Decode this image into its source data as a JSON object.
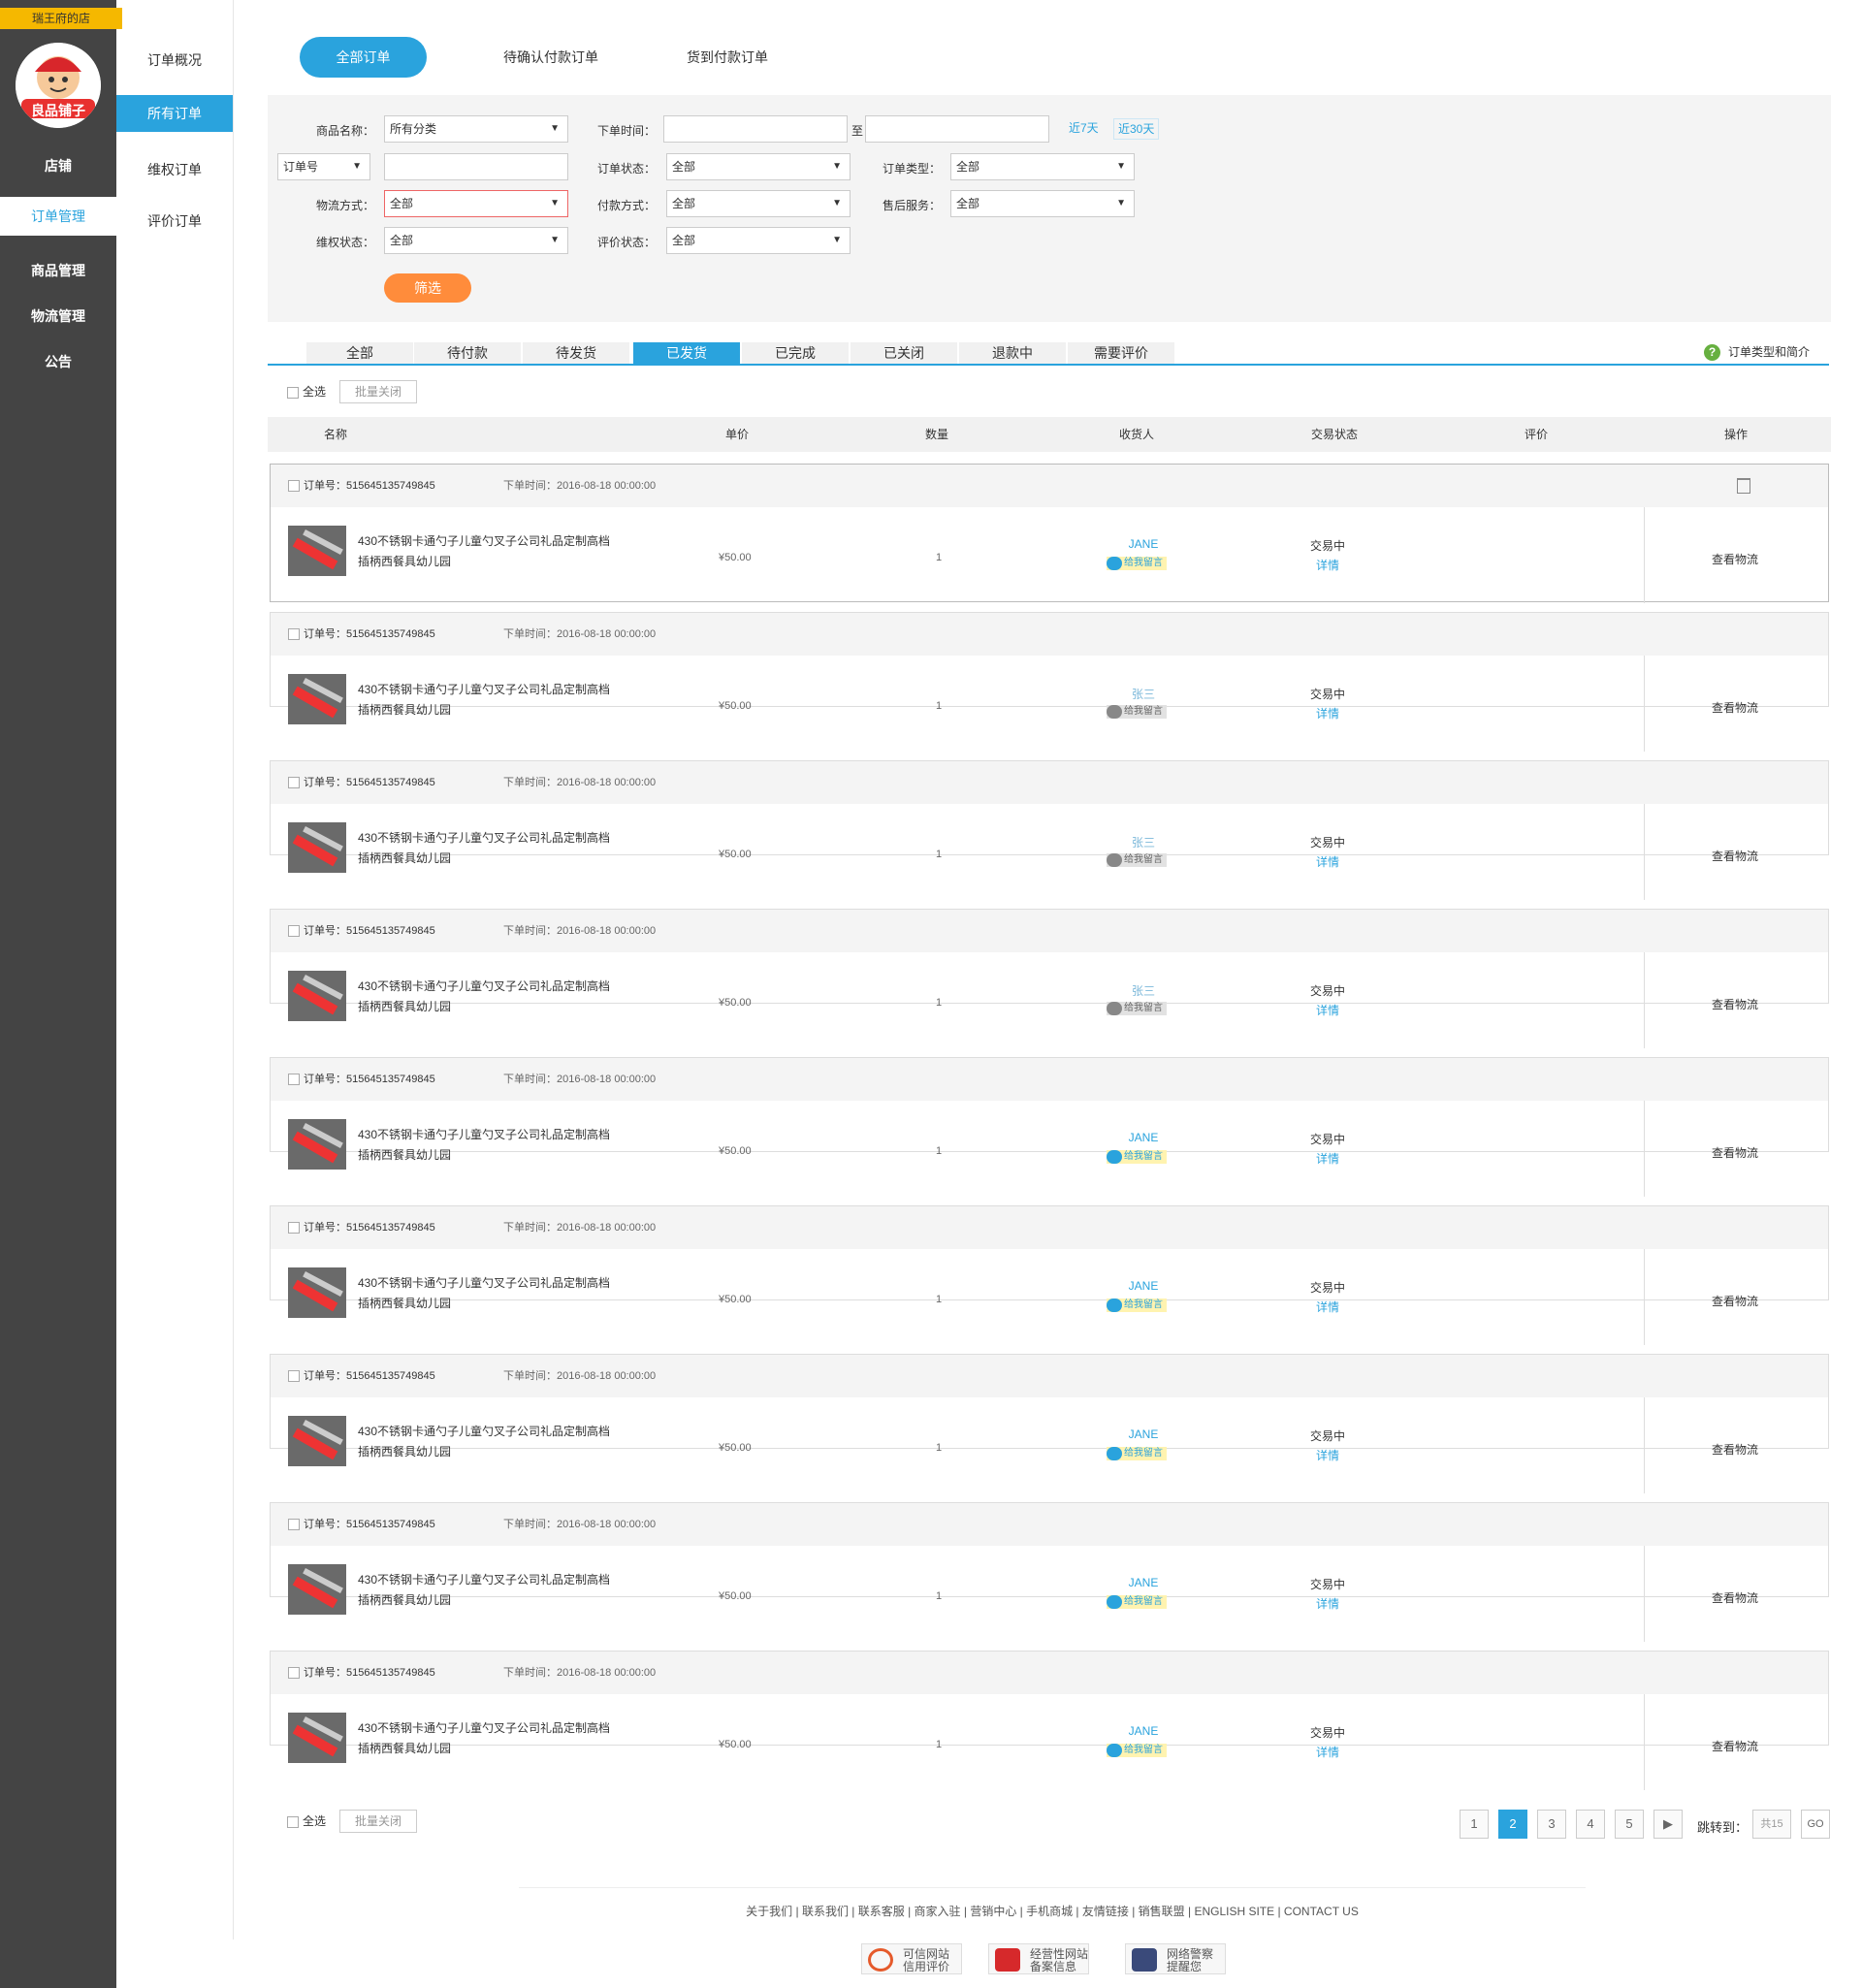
{
  "shop": {
    "name": "瑞王府的店",
    "logo_text": "良品铺子"
  },
  "sidebar": {
    "items": [
      {
        "label": "店铺",
        "active": false
      },
      {
        "label": "订单管理",
        "active": true
      },
      {
        "label": "商品管理",
        "active": false
      },
      {
        "label": "物流管理",
        "active": false
      },
      {
        "label": "公告",
        "active": false
      }
    ]
  },
  "subnav": {
    "items": [
      {
        "label": "订单概况",
        "active": false
      },
      {
        "label": "所有订单",
        "active": true
      },
      {
        "label": "维权订单",
        "active": false
      },
      {
        "label": "评价订单",
        "active": false
      }
    ]
  },
  "top_tabs": [
    {
      "label": "全部订单",
      "active": true
    },
    {
      "label": "待确认付款订单",
      "active": false
    },
    {
      "label": "货到付款订单",
      "active": false
    }
  ],
  "filter": {
    "product_name_label": "商品名称：",
    "product_name_value": "所有分类",
    "order_time_label": "下单时间：",
    "to_label": "至",
    "last7": "近7天",
    "last30": "近30天",
    "order_no_select": "订单号",
    "order_status_label": "订单状态：",
    "order_status_value": "全部",
    "order_type_label": "订单类型：",
    "order_type_value": "全部",
    "logistics_label": "物流方式：",
    "logistics_value": "全部",
    "payment_label": "付款方式：",
    "payment_value": "全部",
    "aftersale_label": "售后服务：",
    "aftersale_value": "全部",
    "rights_label": "维权状态：",
    "rights_value": "全部",
    "review_label": "评价状态：",
    "review_value": "全部",
    "submit": "筛选"
  },
  "status_tabs": [
    {
      "label": "全部",
      "active": false
    },
    {
      "label": "待付款",
      "active": false
    },
    {
      "label": "待发货",
      "active": false
    },
    {
      "label": "已发货",
      "active": true
    },
    {
      "label": "已完成",
      "active": false
    },
    {
      "label": "已关闭",
      "active": false
    },
    {
      "label": "退款中",
      "active": false
    },
    {
      "label": "需要评价",
      "active": false
    }
  ],
  "help_link": "订单类型和简介",
  "bulk": {
    "select_all": "全选",
    "batch_close": "批量关闭"
  },
  "table_headers": [
    "名称",
    "单价",
    "数量",
    "收货人",
    "交易状态",
    "评价",
    "操作"
  ],
  "orders": [
    {
      "order_no": "订单号：515645135749845",
      "time": "下单时间：2016-08-18  00:00:00",
      "name_line1": "430不锈钢卡通勺子儿童勺叉子公司礼品定制高档",
      "name_line2": "插柄西餐具幼儿园",
      "price": "¥50.00",
      "qty": "1",
      "receiver": "JANE",
      "msg": "给我留言",
      "status": "交易中",
      "detail": "详情",
      "action": "查看物流"
    },
    {
      "order_no": "订单号：515645135749845",
      "time": "下单时间：2016-08-18  00:00:00",
      "name_line1": "430不锈钢卡通勺子儿童勺叉子公司礼品定制高档",
      "name_line2": "插柄西餐具幼儿园",
      "price": "¥50.00",
      "qty": "1",
      "receiver": "张三",
      "msg": "给我留言",
      "status": "交易中",
      "detail": "详情",
      "action": "查看物流"
    },
    {
      "order_no": "订单号：515645135749845",
      "time": "下单时间：2016-08-18  00:00:00",
      "name_line1": "430不锈钢卡通勺子儿童勺叉子公司礼品定制高档",
      "name_line2": "插柄西餐具幼儿园",
      "price": "¥50.00",
      "qty": "1",
      "receiver": "张三",
      "msg": "给我留言",
      "status": "交易中",
      "detail": "详情",
      "action": "查看物流"
    },
    {
      "order_no": "订单号：515645135749845",
      "time": "下单时间：2016-08-18  00:00:00",
      "name_line1": "430不锈钢卡通勺子儿童勺叉子公司礼品定制高档",
      "name_line2": "插柄西餐具幼儿园",
      "price": "¥50.00",
      "qty": "1",
      "receiver": "张三",
      "msg": "给我留言",
      "status": "交易中",
      "detail": "详情",
      "action": "查看物流"
    },
    {
      "order_no": "订单号：515645135749845",
      "time": "下单时间：2016-08-18  00:00:00",
      "name_line1": "430不锈钢卡通勺子儿童勺叉子公司礼品定制高档",
      "name_line2": "插柄西餐具幼儿园",
      "price": "¥50.00",
      "qty": "1",
      "receiver": "JANE",
      "msg": "给我留言",
      "status": "交易中",
      "detail": "详情",
      "action": "查看物流"
    },
    {
      "order_no": "订单号：515645135749845",
      "time": "下单时间：2016-08-18  00:00:00",
      "name_line1": "430不锈钢卡通勺子儿童勺叉子公司礼品定制高档",
      "name_line2": "插柄西餐具幼儿园",
      "price": "¥50.00",
      "qty": "1",
      "receiver": "JANE",
      "msg": "给我留言",
      "status": "交易中",
      "detail": "详情",
      "action": "查看物流"
    },
    {
      "order_no": "订单号：515645135749845",
      "time": "下单时间：2016-08-18  00:00:00",
      "name_line1": "430不锈钢卡通勺子儿童勺叉子公司礼品定制高档",
      "name_line2": "插柄西餐具幼儿园",
      "price": "¥50.00",
      "qty": "1",
      "receiver": "JANE",
      "msg": "给我留言",
      "status": "交易中",
      "detail": "详情",
      "action": "查看物流"
    },
    {
      "order_no": "订单号：515645135749845",
      "time": "下单时间：2016-08-18  00:00:00",
      "name_line1": "430不锈钢卡通勺子儿童勺叉子公司礼品定制高档",
      "name_line2": "插柄西餐具幼儿园",
      "price": "¥50.00",
      "qty": "1",
      "receiver": "JANE",
      "msg": "给我留言",
      "status": "交易中",
      "detail": "详情",
      "action": "查看物流"
    },
    {
      "order_no": "订单号：515645135749845",
      "time": "下单时间：2016-08-18  00:00:00",
      "name_line1": "430不锈钢卡通勺子儿童勺叉子公司礼品定制高档",
      "name_line2": "插柄西餐具幼儿园",
      "price": "¥50.00",
      "qty": "1",
      "receiver": "JANE",
      "msg": "给我留言",
      "status": "交易中",
      "detail": "详情",
      "action": "查看物流"
    }
  ],
  "pagination": {
    "pages": [
      "1",
      "2",
      "3",
      "4",
      "5"
    ],
    "current": "2",
    "next": "▶",
    "jump_label": "跳转到：",
    "total": "共15",
    "go": "GO"
  },
  "footer": {
    "links": "关于我们 | 联系我们 | 联系客服 | 商家入驻 | 营销中心 | 手机商城 | 友情链接 | 销售联盟 | ENGLISH SITE | CONTACT US",
    "badges": [
      {
        "line1": "可信网站",
        "line2": "信用评价"
      },
      {
        "line1": "经营性网站",
        "line2": "备案信息"
      },
      {
        "line1": "网络警察",
        "line2": "提醒您"
      }
    ]
  },
  "colors": {
    "accent": "#2aa3dd",
    "sidebar": "#444444",
    "shop_tag": "#f5b800",
    "filter_button": "#ff8c3b"
  }
}
